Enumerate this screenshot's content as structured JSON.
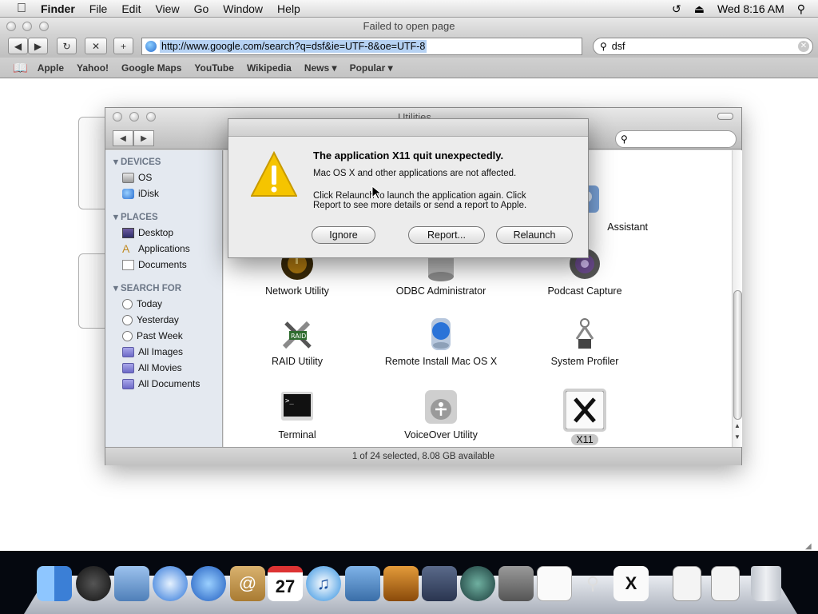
{
  "menubar": {
    "items": [
      "Finder",
      "File",
      "Edit",
      "View",
      "Go",
      "Window",
      "Help"
    ],
    "clock": "Wed 8:16 AM"
  },
  "safari": {
    "window_title": "Failed to open page",
    "url": "http://www.google.com/search?q=dsf&ie=UTF-8&oe=UTF-8",
    "search_value": "dsf",
    "bookmarks": [
      "Apple",
      "Yahoo!",
      "Google Maps",
      "YouTube",
      "Wikipedia",
      "News ▾",
      "Popular ▾"
    ]
  },
  "finder": {
    "title": "Utilities",
    "sidebar": {
      "devices_header": "DEVICES",
      "devices": [
        "OS",
        "iDisk"
      ],
      "places_header": "PLACES",
      "places": [
        "Desktop",
        "Applications",
        "Documents"
      ],
      "search_header": "SEARCH FOR",
      "search": [
        "Today",
        "Yesterday",
        "Past Week",
        "All Images",
        "All Movies",
        "All Documents"
      ]
    },
    "apps": {
      "row1_right": "Assistant",
      "row2": [
        "Network Utility",
        "ODBC Administrator",
        "Podcast Capture"
      ],
      "row3": [
        "RAID Utility",
        "Remote Install Mac OS X",
        "System Profiler"
      ],
      "row4": [
        "Terminal",
        "VoiceOver Utility",
        "X11"
      ]
    },
    "status": "1 of 24 selected, 8.08 GB available"
  },
  "alert": {
    "title": "The application X11 quit unexpectedly.",
    "message1": "Mac OS X and other applications are not affected.",
    "message2": "Click Relaunch to launch the application again. Click Report to see more details or send a report to Apple.",
    "buttons": {
      "ignore": "Ignore",
      "report": "Report...",
      "relaunch": "Relaunch"
    }
  },
  "dock": {
    "icons": [
      "finder-icon",
      "dashboard-icon",
      "mail-icon",
      "safari-icon",
      "ichat-icon",
      "address-book-icon",
      "ical-icon",
      "itunes-icon",
      "iphoto-icon",
      "photo-booth-icon",
      "spaces-icon",
      "time-machine-icon",
      "system-preferences-icon",
      "textedit-icon",
      "system-profiler-icon",
      "x11-icon",
      "pdf-document-icon",
      "pdf-document-icon",
      "trash-icon"
    ],
    "ical_day": "27"
  },
  "colors": {
    "accent": "#2b6fd0",
    "selection": "#b6d2f3",
    "alert_icon": "#f5c400"
  }
}
